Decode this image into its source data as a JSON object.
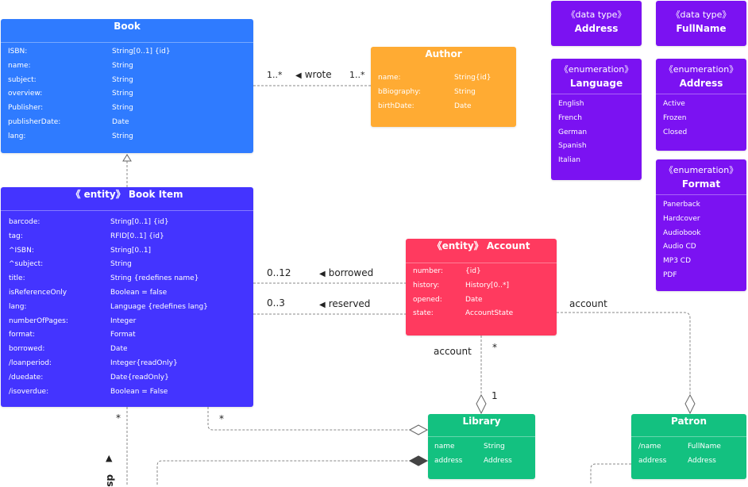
{
  "classes": {
    "book": {
      "title": "Book",
      "attributes": [
        {
          "name": "ISBN:",
          "type": "String[0..1] {id}"
        },
        {
          "name": "name:",
          "type": "String"
        },
        {
          "name": "subject:",
          "type": "String"
        },
        {
          "name": "overview:",
          "type": "String"
        },
        {
          "name": "Publisher:",
          "type": "String"
        },
        {
          "name": "publisherDate:",
          "type": "Date"
        },
        {
          "name": "lang:",
          "type": "String"
        }
      ],
      "color": "#2f7bff"
    },
    "author": {
      "title": "Author",
      "attributes": [
        {
          "name": "name:",
          "type": "String{id}"
        },
        {
          "name": "bBiography:",
          "type": "String"
        },
        {
          "name": "birthDate:",
          "type": "Date"
        }
      ],
      "color": "#ffab33"
    },
    "book_item": {
      "stereotype": "《 entity》",
      "title": "Book Item",
      "attributes": [
        {
          "name": "barcode:",
          "type": "String[0..1] {id}"
        },
        {
          "name": "tag:",
          "type": "RFID[0..1] {id}"
        },
        {
          "name": "^ISBN:",
          "type": "String[0..1]"
        },
        {
          "name": "^subject:",
          "type": "String"
        },
        {
          "name": "title:",
          "type": "String {redefines name}"
        },
        {
          "name": "isReferenceOnly",
          "type": "Boolean = false"
        },
        {
          "name": "lang:",
          "type": "Language {redefines lang}"
        },
        {
          "name": "numberOfPages:",
          "type": "Integer"
        },
        {
          "name": "format:",
          "type": "Format"
        },
        {
          "name": "borrowed:",
          "type": "Date"
        },
        {
          "name": "/loanperiod:",
          "type": "Integer{readOnly}"
        },
        {
          "name": "/duedate:",
          "type": "Date{readOnly}"
        },
        {
          "name": "/isoverdue:",
          "type": "Boolean = False"
        }
      ],
      "color": "#4434ff"
    },
    "account": {
      "stereotype": "《entity》",
      "title": "Account",
      "attributes": [
        {
          "name": "number:",
          "type": "{id}"
        },
        {
          "name": "history:",
          "type": "History[0..*]"
        },
        {
          "name": "opened:",
          "type": "Date"
        },
        {
          "name": "state:",
          "type": "AccountState"
        }
      ],
      "color": "#ff3a5f"
    },
    "library": {
      "title": "Library",
      "attributes": [
        {
          "name": "name",
          "type": "String"
        },
        {
          "name": "address",
          "type": "Address"
        }
      ],
      "color": "#13c180"
    },
    "patron": {
      "title": "Patron",
      "attributes": [
        {
          "name": "/name",
          "type": "FullName"
        },
        {
          "name": "address",
          "type": "Address"
        }
      ],
      "color": "#13c180"
    },
    "datatype_address": {
      "stereotype": "《data type》",
      "title": "Address"
    },
    "datatype_fullname": {
      "stereotype": "《data type》",
      "title": "FullName"
    },
    "enum_language": {
      "stereotype": "《enumeration》",
      "title": "Language",
      "literals": [
        "English",
        "French",
        "German",
        "Spanish",
        "Italian"
      ]
    },
    "enum_address": {
      "stereotype": "《enumeration》",
      "title": "Address",
      "literals": [
        "Active",
        "Frozen",
        "Closed"
      ]
    },
    "enum_format": {
      "stereotype": "《enumeration》",
      "title": "Format",
      "literals": [
        "Panerback",
        "Hardcover",
        "Audiobook",
        "Audio CD",
        "MP3 CD",
        "PDF"
      ]
    }
  },
  "associations": {
    "wrote": {
      "label": "wrote",
      "left_multiplicity": "1..*",
      "right_multiplicity": "1..*",
      "direction_icon": "triangle-left"
    },
    "borrowed": {
      "label": "borrowed",
      "multiplicity": "0..12",
      "direction_icon": "triangle-left"
    },
    "reserved": {
      "label": "reserved",
      "multiplicity": "0..3",
      "direction_icon": "triangle-left"
    },
    "account_library": {
      "role": "account",
      "account_multiplicity": "*",
      "library_multiplicity": "1"
    },
    "account_patron": {
      "role": "account"
    },
    "bookitem_library": {
      "bookitem_multiplicity": "*"
    },
    "bookitem_left": {
      "multiplicity": "*",
      "label_partial": "ds",
      "direction_icon": "triangle-up"
    }
  },
  "palette": {
    "purple": "#7b12f2",
    "connector": "#888888",
    "composition": "#444444"
  }
}
